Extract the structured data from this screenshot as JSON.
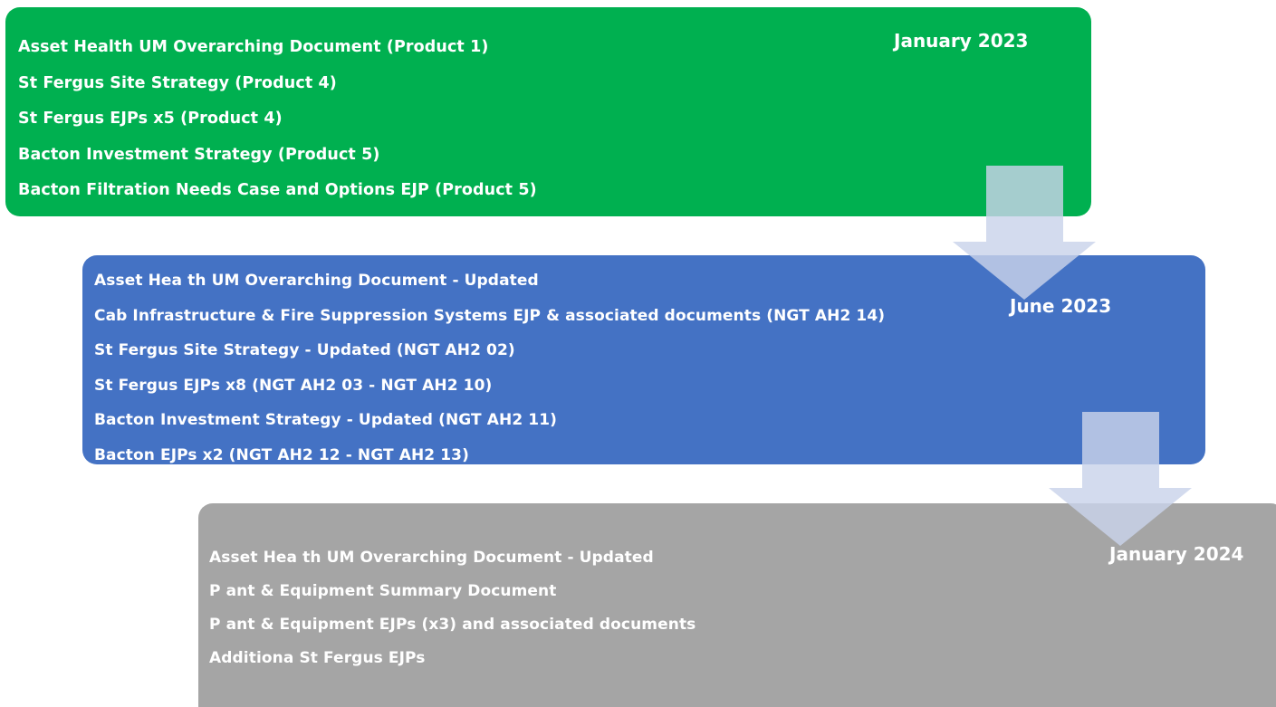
{
  "colors": {
    "stage_1": "#00b050",
    "stage_2": "#4472c4",
    "stage_3": "#a5a5a5",
    "arrow": "#c9d3ea",
    "text": "#ffffff"
  },
  "stages": [
    {
      "date": "January 2023",
      "items": [
        "Asset Health UM Overarching Document (Product 1)",
        "St Fergus Site Strategy (Product 4)",
        "St Fergus EJPs x5 (Product 4)",
        "Bacton Investment Strategy (Product 5)",
        "Bacton Filtration Needs Case and Options EJP (Product 5)"
      ]
    },
    {
      "date": "June 2023",
      "items": [
        "Asset Hea th UM Overarching Document - Updated",
        "Cab Infrastructure & Fire Suppression Systems EJP & associated documents (NGT  AH2  14)",
        "St Fergus Site Strategy - Updated (NGT  AH2  02)",
        "St Fergus EJPs x8 (NGT  AH2  03 - NGT  AH2  10)",
        "Bacton Investment Strategy - Updated (NGT  AH2  11)",
        "Bacton EJPs x2 (NGT  AH2  12 - NGT  AH2  13)"
      ]
    },
    {
      "date": "January 2024",
      "items": [
        "Asset Hea th UM Overarching Document - Updated",
        "P ant & Equipment Summary Document",
        "P ant & Equipment EJPs (x3) and associated documents",
        "Additiona  St Fergus EJPs"
      ]
    }
  ]
}
